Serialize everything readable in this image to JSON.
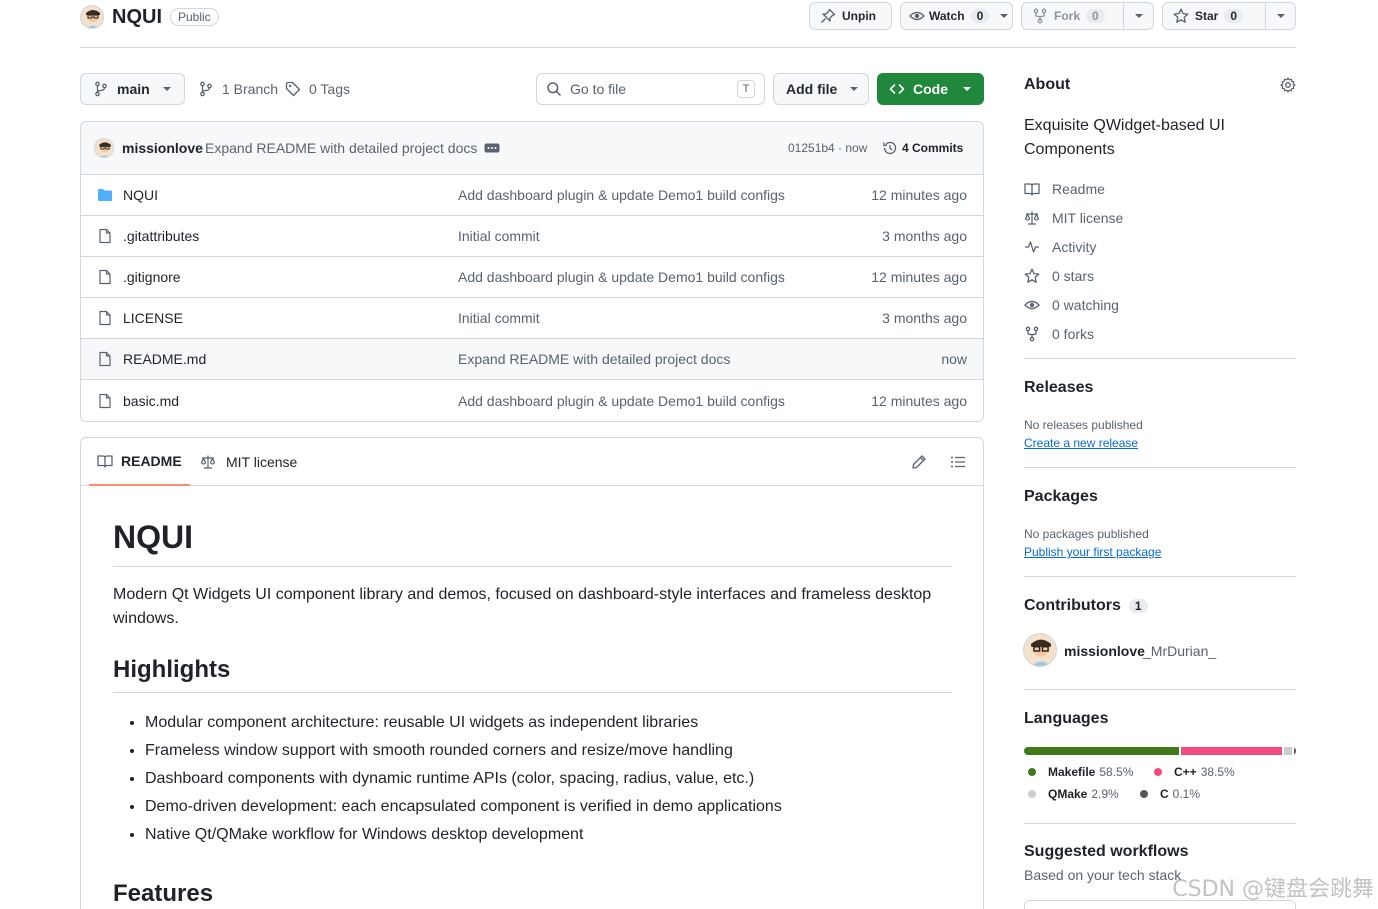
{
  "repo": {
    "name": "NQUI",
    "visibility": "Public",
    "pin_label": "Unpin",
    "watch_label": "Watch",
    "watch_count": "0",
    "fork_label": "Fork",
    "fork_count": "0",
    "star_label": "Star",
    "star_count": "0"
  },
  "toolbar": {
    "branch": "main",
    "branch_count": "1 Branch",
    "tag_count": "0 Tags",
    "search_placeholder": "Go to file",
    "search_shortcut": "T",
    "add_file_label": "Add file",
    "code_label": "Code"
  },
  "latest_commit": {
    "author": "missionlove",
    "message": "Expand README with detailed project docs",
    "hash": "01251b4",
    "time": "· now",
    "commits_label": "4 Commits"
  },
  "files": [
    {
      "name": "NQUI",
      "type": "folder",
      "message": "Add dashboard plugin & update Demo1 build configs",
      "time": "12 minutes ago"
    },
    {
      "name": ".gitattributes",
      "type": "file",
      "message": "Initial commit",
      "time": "3 months ago"
    },
    {
      "name": ".gitignore",
      "type": "file",
      "message": "Add dashboard plugin & update Demo1 build configs",
      "time": "12 minutes ago"
    },
    {
      "name": "LICENSE",
      "type": "file",
      "message": "Initial commit",
      "time": "3 months ago"
    },
    {
      "name": "README.md",
      "type": "file",
      "message": "Expand README with detailed project docs",
      "time": "now"
    },
    {
      "name": "basic.md",
      "type": "file",
      "message": "Add dashboard plugin & update Demo1 build configs",
      "time": "12 minutes ago"
    }
  ],
  "readme": {
    "tab_readme": "README",
    "tab_license": "MIT license",
    "title": "NQUI",
    "intro": "Modern Qt Widgets UI component library and demos, focused on dashboard-style interfaces and frameless desktop windows.",
    "highlights_heading": "Highlights",
    "highlights": [
      "Modular component architecture: reusable UI widgets as independent libraries",
      "Frameless window support with smooth rounded corners and resize/move handling",
      "Dashboard components with dynamic runtime APIs (color, spacing, radius, value, etc.)",
      "Demo-driven development: each encapsulated component is verified in demo applications",
      "Native Qt/QMake workflow for Windows desktop development"
    ],
    "features_heading": "Features"
  },
  "about": {
    "heading": "About",
    "description": "Exquisite QWidget-based UI Components",
    "links": {
      "readme": "Readme",
      "license": "MIT license",
      "activity": "Activity",
      "stars": "0 stars",
      "watching": "0 watching",
      "forks": "0 forks"
    }
  },
  "releases": {
    "heading": "Releases",
    "empty": "No releases published",
    "link": "Create a new release"
  },
  "packages": {
    "heading": "Packages",
    "empty": "No packages published",
    "link": "Publish your first package"
  },
  "contributors": {
    "heading": "Contributors",
    "count": "1",
    "login": "missionlove",
    "name": "_MrDurian_"
  },
  "languages": {
    "heading": "Languages",
    "items": [
      {
        "name": "Makefile",
        "percent": "58.5%",
        "value": 58.5,
        "color": "#427819"
      },
      {
        "name": "C++",
        "percent": "38.5%",
        "value": 38.5,
        "color": "#f34b7d"
      },
      {
        "name": "QMake",
        "percent": "2.9%",
        "value": 2.9,
        "color": "#cccccc"
      },
      {
        "name": "C",
        "percent": "0.1%",
        "value": 0.1,
        "color": "#555555"
      }
    ]
  },
  "workflows": {
    "heading": "Suggested workflows",
    "subtitle": "Based on your tech stack"
  },
  "watermark": "CSDN @键盘会跳舞"
}
